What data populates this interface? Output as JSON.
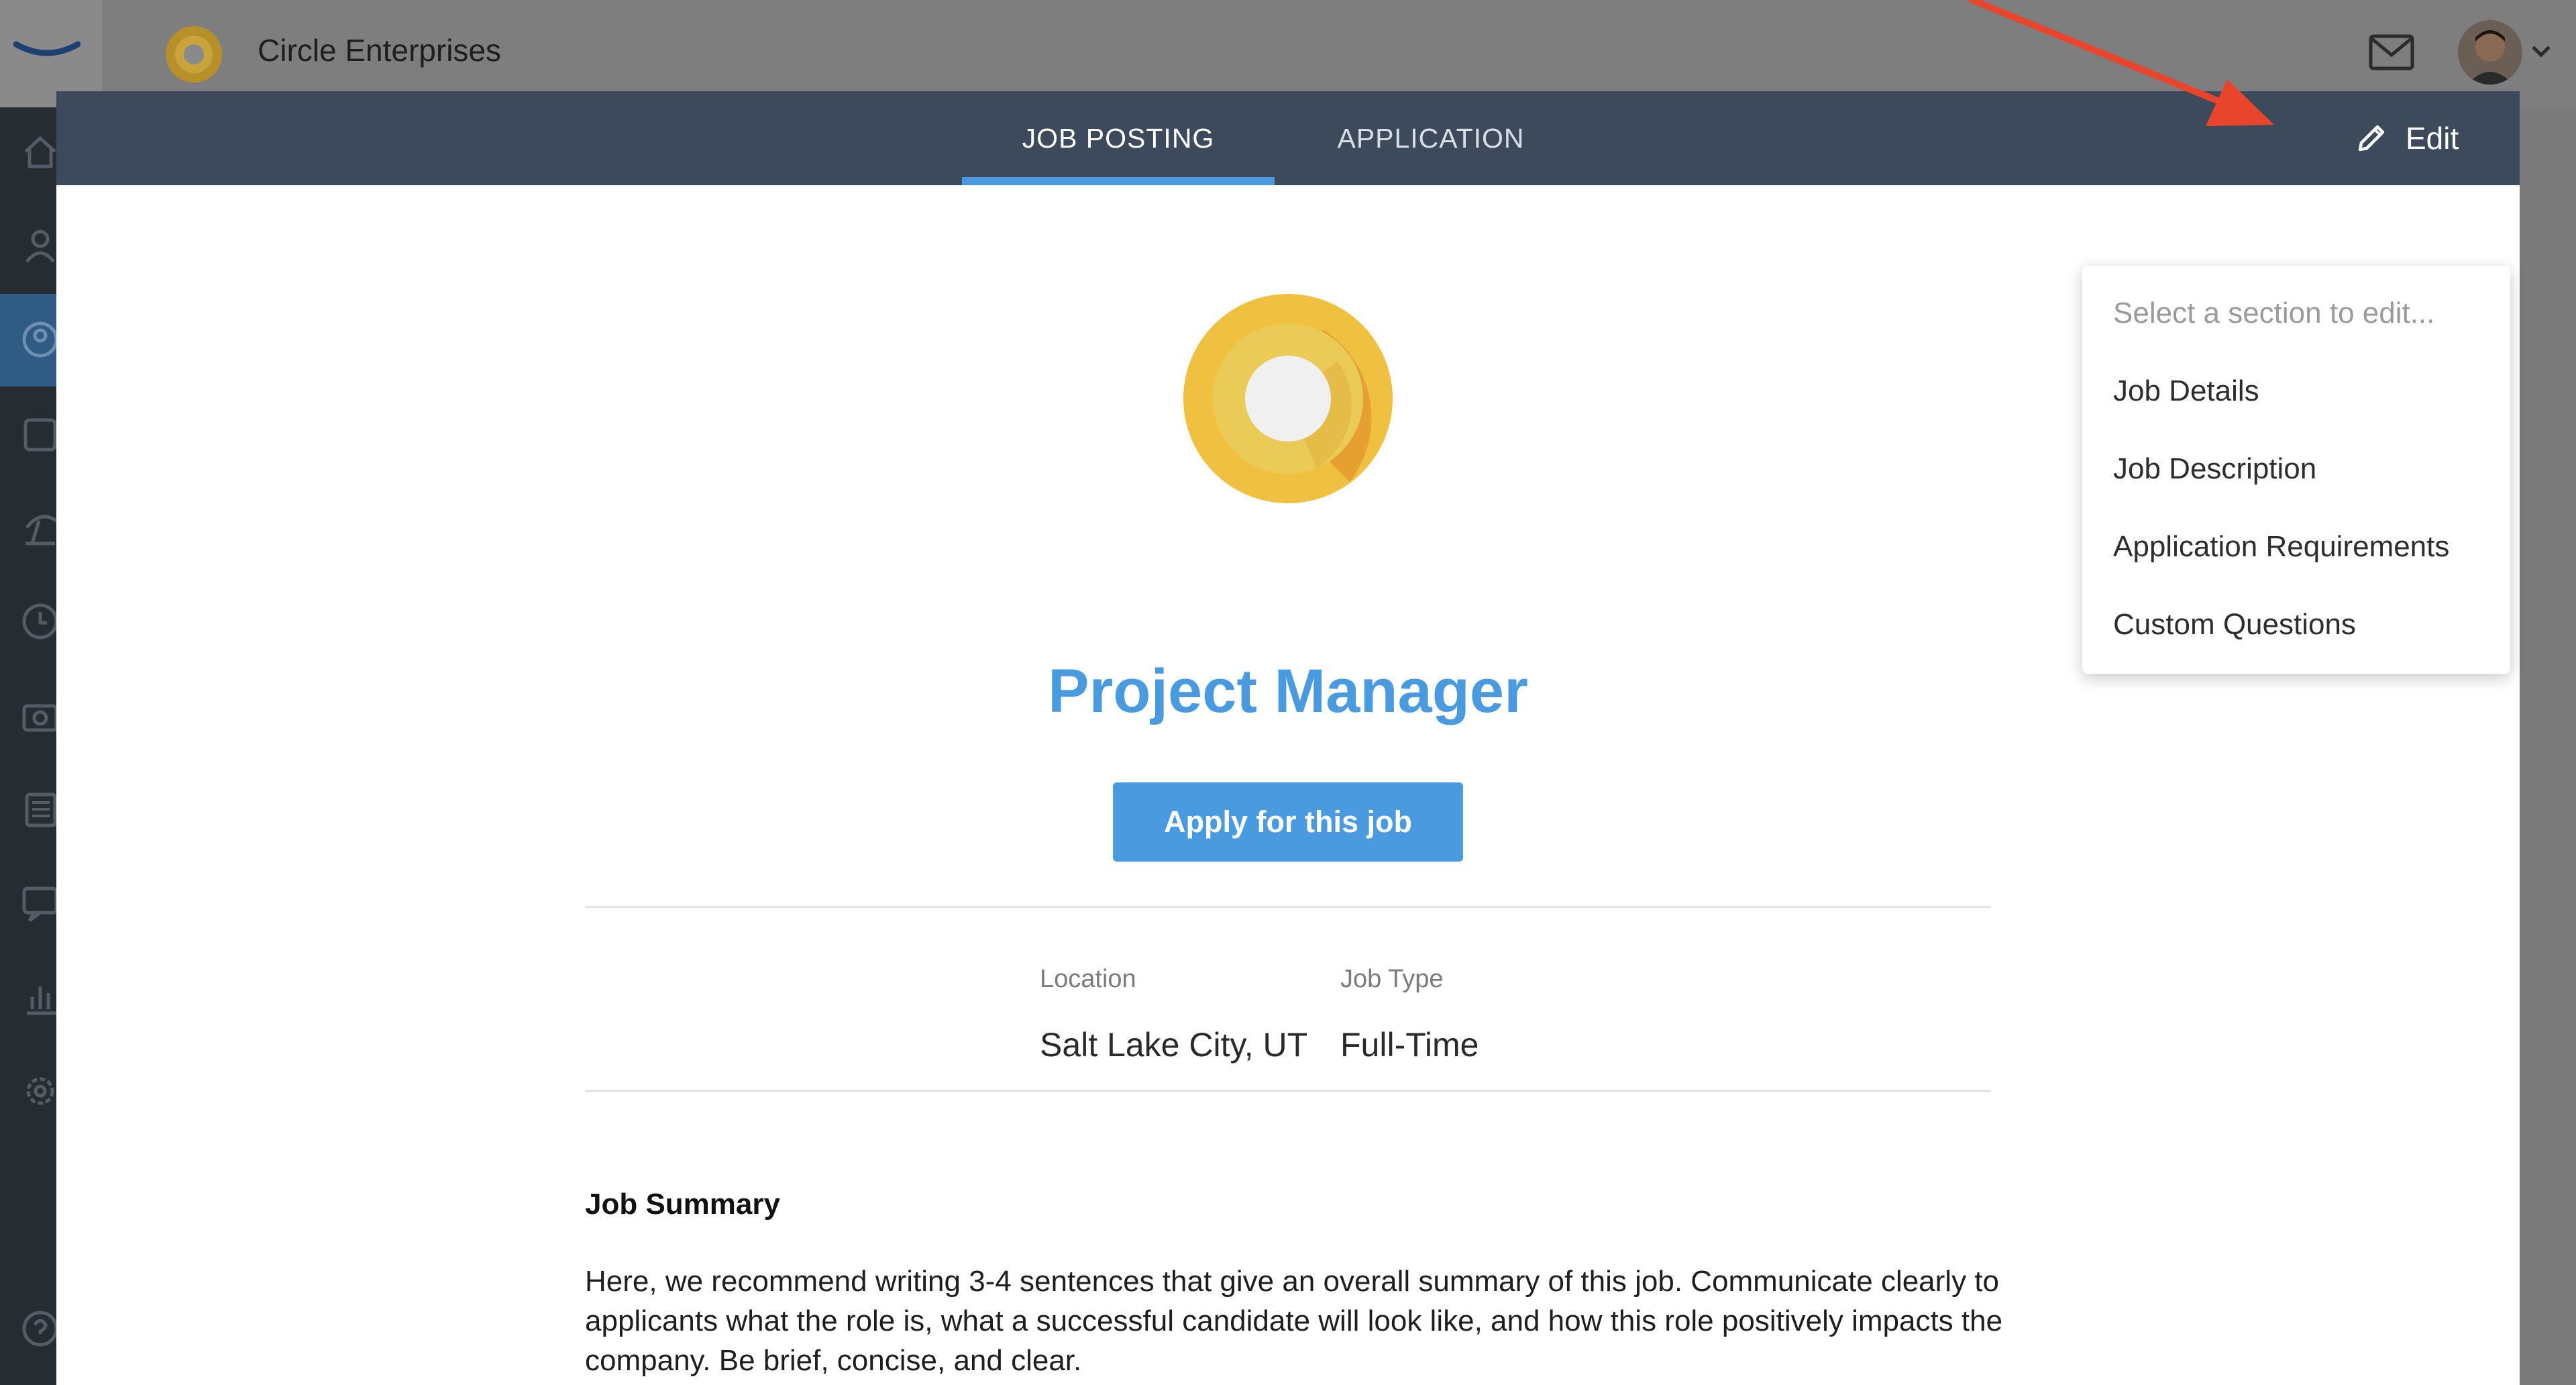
{
  "app": {
    "company_name": "Circle Enterprises"
  },
  "modal": {
    "tabs": [
      {
        "label": "JOB POSTING",
        "active": true
      },
      {
        "label": "APPLICATION",
        "active": false
      }
    ],
    "edit_label": "Edit"
  },
  "edit_menu": {
    "placeholder": "Select a section to edit...",
    "items": [
      "Job Details",
      "Job Description",
      "Application Requirements",
      "Custom Questions"
    ]
  },
  "job": {
    "title": "Project Manager",
    "apply_label": "Apply for this job",
    "location_label": "Location",
    "location_value": "Salt Lake City, UT",
    "type_label": "Job Type",
    "type_value": "Full-Time",
    "summary_heading": "Job Summary",
    "summary_text": "Here, we recommend writing 3-4 sentences that give an overall summary of this job. Communicate clearly to applicants what the role is, what a successful candidate will look like, and how this role positively impacts the company. Be brief, concise, and clear."
  },
  "colors": {
    "accent": "#4a9ae0",
    "header": "#3d4a5c",
    "logo_yellow": "#f0c040",
    "annotation_red": "#e8452c"
  },
  "icons": [
    "brand-swoosh-icon",
    "mail-icon",
    "chevron-down-icon",
    "pencil-icon",
    "home-icon",
    "person-icon",
    "user-circle-icon",
    "folder-icon",
    "beach-icon",
    "clock-icon",
    "camera-icon",
    "news-icon",
    "chat-icon",
    "bar-chart-icon",
    "gear-icon",
    "help-icon"
  ]
}
